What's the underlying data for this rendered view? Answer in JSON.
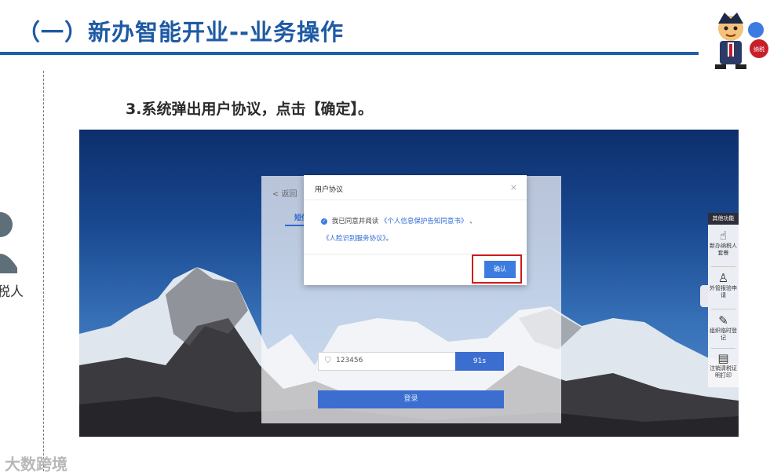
{
  "slide": {
    "title": "（一）新办智能开业--业务操作",
    "step": "3.系统弹出用户协议，点击【确定】。",
    "side_label": "税人",
    "watermark": "大数跨境"
  },
  "colors": {
    "title": "#1e5aa3",
    "rule": "#1f5fa6",
    "primary": "#3c7be0",
    "highlight": "#d0191b"
  },
  "login": {
    "back": "< 返回",
    "tab": "短信",
    "code_value": "123456",
    "countdown": "91s",
    "login_button": "登录"
  },
  "dialog": {
    "title": "用户协议",
    "close": "×",
    "agree_prefix": "我已同意并阅读",
    "link1": "《个人信息保护告知同意书》",
    "sep": "、",
    "link2": "《人脸识别服务协议》",
    "end": "。",
    "confirm": "确认"
  },
  "side_panel": {
    "title": "其他功能",
    "items": [
      {
        "icon": "hand-pointer-icon",
        "label": "新办纳税人套餐"
      },
      {
        "icon": "person-icon",
        "label": "外管报验申请"
      },
      {
        "icon": "pen-icon",
        "label": "组织临时登记"
      },
      {
        "icon": "document-icon",
        "label": "注销清税证明打印"
      }
    ]
  }
}
